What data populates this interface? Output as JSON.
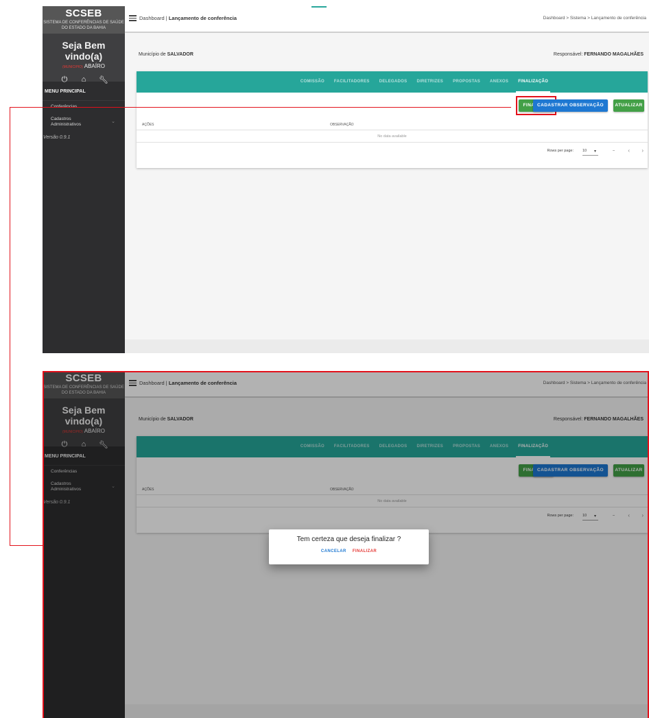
{
  "app": {
    "name": "SCSEB",
    "subtitle": "SISTEMA DE CONFERÊNCIAS DE SAÚDE DO ESTADO DA BAHIA",
    "welcome": "Seja Bem vindo(a)",
    "user_tag": "(municipio)",
    "user_name": "ABAÍRO",
    "version": "Versão 0.9.1"
  },
  "sidebar": {
    "menu_title": "MENU PRINCIPAL",
    "items": [
      {
        "label": "Conferências"
      },
      {
        "label": "Cadastros Administrativos"
      }
    ],
    "icons": [
      "power-icon",
      "home-icon",
      "wrench-icon"
    ]
  },
  "header": {
    "dashboard_label": "Dashboard |",
    "page_title": "Lançamento de conferência",
    "breadcrumb": "Dashboard  >  Sistema  >  Lançamento de conferência"
  },
  "page": {
    "municipio_prefix": "Município de ",
    "municipio": "SALVADOR",
    "responsavel_prefix": "Responsável: ",
    "responsavel": "FERNANDO MAGALHÃES"
  },
  "tabs": [
    "COMISSÃO",
    "FACILITADORES",
    "DELEGADOS",
    "DIRETRIZES",
    "PROPOSTAS",
    "ANEXOS",
    "FINALIZAÇÃO"
  ],
  "active_tab": "FINALIZAÇÃO",
  "buttons": {
    "finalizar": "FINALIZAR",
    "cadastrar": "CADASTRAR OBSERVAÇÃO",
    "atualizar": "ATUALIZAR"
  },
  "table": {
    "columns": [
      "AÇÕES",
      "OBSERVAÇÃO"
    ],
    "empty_text": "No data available",
    "rows_per_page_label": "Rows per page:",
    "rows_per_page": "10",
    "range": "–"
  },
  "dialog": {
    "title": "Tem certeza que deseja finalizar ?",
    "cancel": "CANCELAR",
    "confirm": "FINALIZAR"
  },
  "colors": {
    "teal": "#26a69a",
    "green": "#43a047",
    "blue": "#1e78d2",
    "highlight": "#e2101a"
  }
}
